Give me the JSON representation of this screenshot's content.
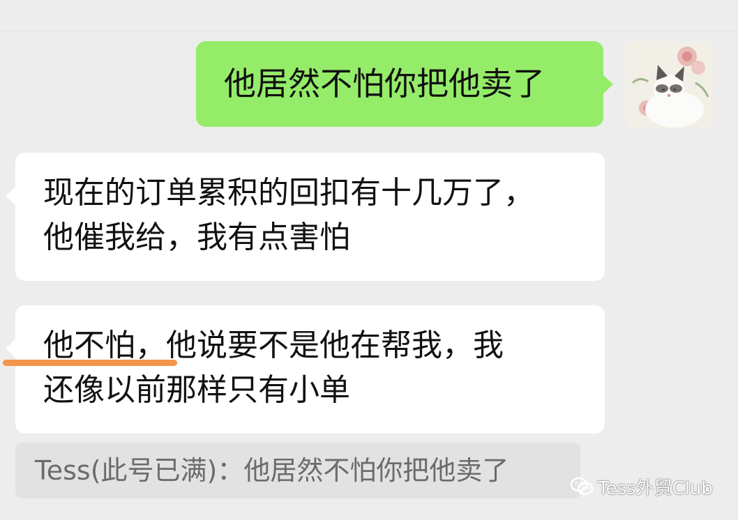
{
  "chat": {
    "outgoing_message": "他居然不怕你把他卖了",
    "incoming_messages": [
      {
        "lines": [
          "现在的订单累积的回扣有十几万了，",
          "他催我给，我有点害怕"
        ]
      },
      {
        "lines": [
          "他不怕，他说要不是他在帮我，我",
          "还像以前那样只有小单"
        ]
      }
    ],
    "quote": "Tess(此号已满)：他居然不怕你把他卖了",
    "avatar_icon": "cat-avatar-icon"
  },
  "watermark": {
    "text": "Tess外贸Club",
    "icon": "wechat-icon"
  },
  "colors": {
    "background": "#ededed",
    "outgoing_bubble": "#95ec69",
    "incoming_bubble": "#ffffff",
    "highlight_underline": "#f2954c",
    "quote_background": "#e2e2e2"
  }
}
